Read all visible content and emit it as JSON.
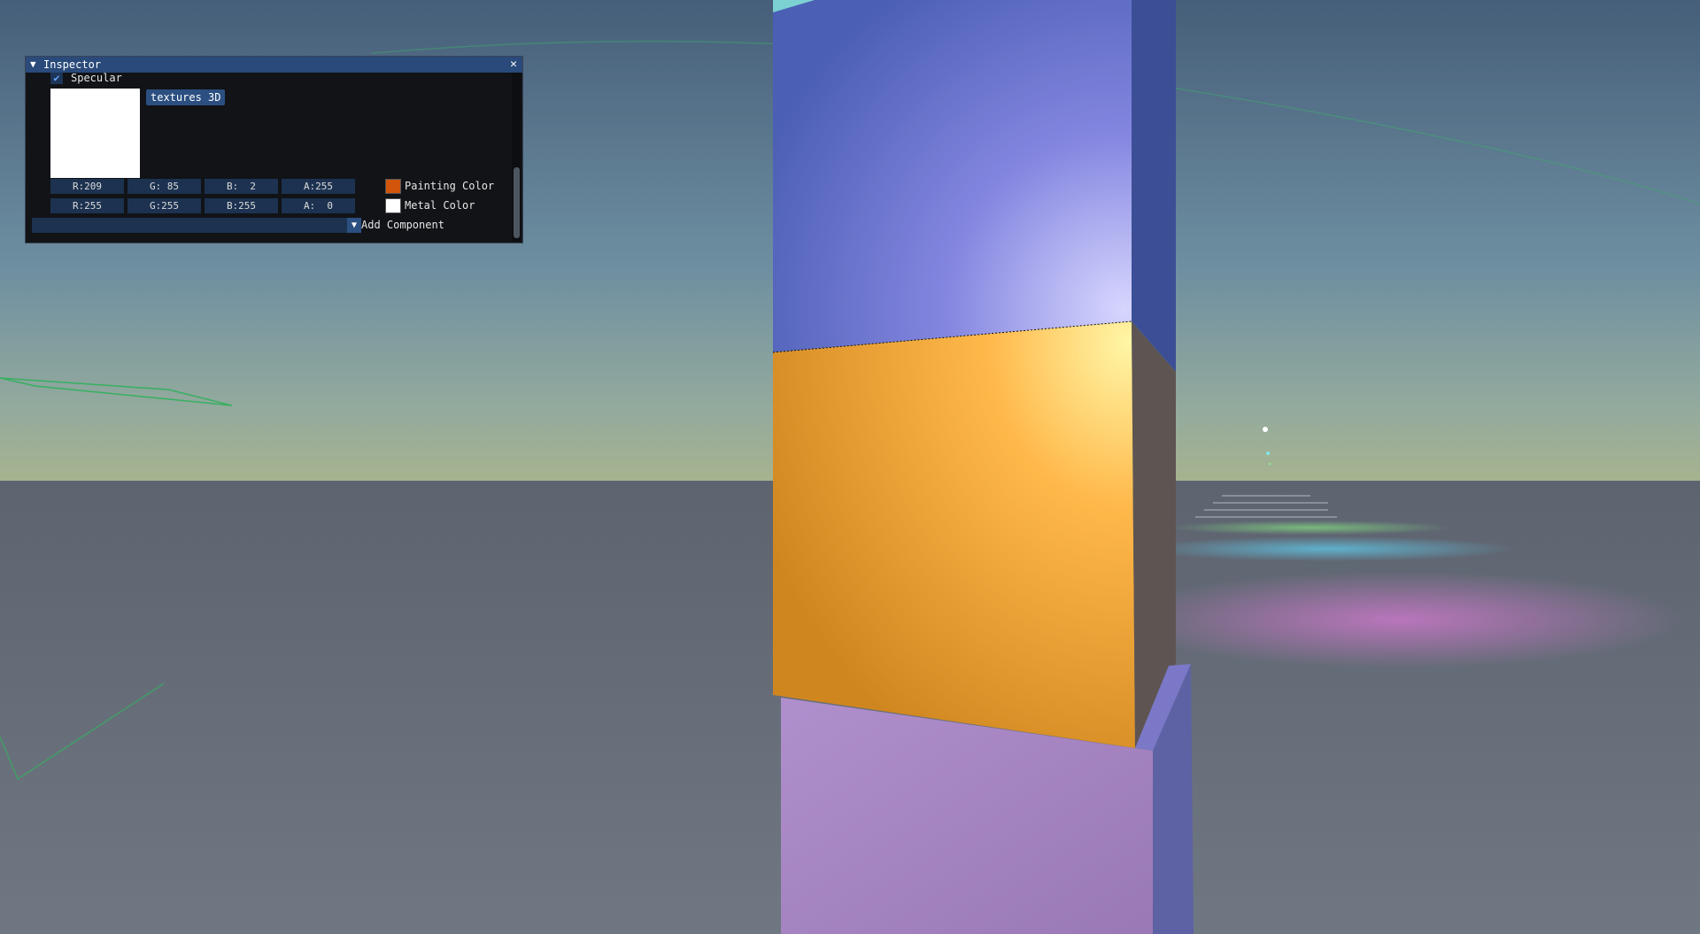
{
  "window": {
    "title": "Inspector",
    "collapse_icon": "triangle-down-icon",
    "close_icon": "close-icon"
  },
  "specular": {
    "label": "Specular",
    "checked": true
  },
  "texture": {
    "button_label": "textures 3D",
    "preview_color": "#ffffff"
  },
  "painting_color": {
    "r": "R:209",
    "g": "G: 85",
    "b": "B:  2",
    "a": "A:255",
    "label": "Painting Color",
    "swatch": "#d1550b"
  },
  "metal_color": {
    "r": "R:255",
    "g": "G:255",
    "b": "B:255",
    "a": "A:  0",
    "label": "Metal Color",
    "swatch": "#ffffff"
  },
  "add_component": {
    "label": "Add Component",
    "value": ""
  },
  "scene_colors": {
    "sky_top": "#4a637c",
    "sky_horizon": "#a2b191",
    "ground": "#5f6670",
    "top_cube": "#6a78d8",
    "middle_cube": "#f2a23a",
    "bottom_cube": "#a583c2"
  }
}
